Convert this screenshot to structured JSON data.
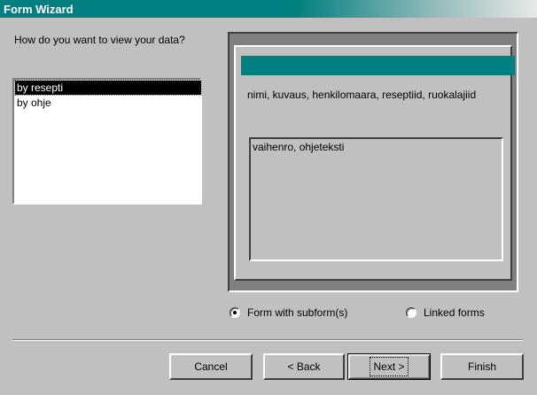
{
  "window": {
    "title": "Form Wizard"
  },
  "question": "How do you want to view your data?",
  "view_options": [
    {
      "label": "by resepti",
      "selected": true
    },
    {
      "label": "by ohje",
      "selected": false
    }
  ],
  "preview": {
    "main_fields": "nimi, kuvaus, henkilomaara, reseptiid, ruokalajiid",
    "subform_fields": "vaihenro, ohjeteksti"
  },
  "layout_options": {
    "form_with_subform": {
      "label": "Form with subform(s)",
      "checked": true
    },
    "linked_forms": {
      "label": "Linked forms",
      "checked": false
    }
  },
  "buttons": {
    "cancel": "Cancel",
    "back": "< Back",
    "next": "Next >",
    "finish": "Finish"
  },
  "colors": {
    "accent": "#008080",
    "face": "#c0c0c0"
  }
}
